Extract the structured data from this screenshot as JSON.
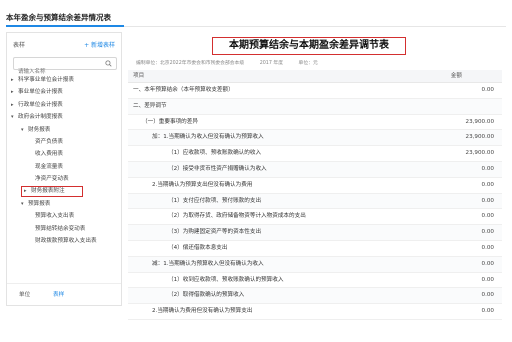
{
  "page": {
    "title": "本年盈余与预算结余差异情况表"
  },
  "sidebar": {
    "header": "表样",
    "add_label": "+ 新增表样",
    "search_placeholder": "请输入名称",
    "tree": [
      {
        "label": "科学事业单位会计报表",
        "arrow": "▸",
        "level": 0
      },
      {
        "label": "事业单位会计报表",
        "arrow": "▸",
        "level": 0
      },
      {
        "label": "行政单位会计报表",
        "arrow": "▸",
        "level": 0
      },
      {
        "label": "政府会计制度报表",
        "arrow": "▾",
        "level": 0
      },
      {
        "label": "财务报表",
        "arrow": "▾",
        "level": 1
      },
      {
        "label": "资产负债表",
        "arrow": "",
        "level": 2
      },
      {
        "label": "收入费用表",
        "arrow": "",
        "level": 2
      },
      {
        "label": "现金流量表",
        "arrow": "",
        "level": 2
      },
      {
        "label": "净资产变动表",
        "arrow": "",
        "level": 2
      },
      {
        "label": "财务报表附注",
        "arrow": "▸",
        "level": 1,
        "selected": true
      },
      {
        "label": "预算报表",
        "arrow": "▾",
        "level": 1
      },
      {
        "label": "预算收入支出表",
        "arrow": "",
        "level": 2
      },
      {
        "label": "预算结转结余变动表",
        "arrow": "",
        "level": 2
      },
      {
        "label": "财政拨款预算收入支出表",
        "arrow": "",
        "level": 2
      }
    ],
    "footer": {
      "tab_unit": "单位",
      "tab_table": "表样"
    }
  },
  "report": {
    "title": "本期预算结余与本期盈余差异调节表",
    "meta": [
      "编制单位：北京2022年市委会和市残委会部会本级",
      "2017 年度",
      "单位：元"
    ],
    "columns": {
      "item": "项目",
      "amount": "金额"
    },
    "rows": [
      {
        "label": "一、本年预算结余（本年预算收支差额）",
        "amount": "0.00",
        "indent": 0
      },
      {
        "label": "二、差异调节",
        "amount": "",
        "indent": 0
      },
      {
        "label": "（一）重要事项的差异",
        "amount": "23,900.00",
        "indent": 1
      },
      {
        "label": "加：1.当期确认为收入但没有确认为预算收入",
        "amount": "23,900.00",
        "indent": 2
      },
      {
        "label": "（1）应收款项、预收账款确认的收入",
        "amount": "23,900.00",
        "indent": 3
      },
      {
        "label": "（2）接受非货币性资产捐赠确认为收入",
        "amount": "0.00",
        "indent": 3
      },
      {
        "label": "2.当期确认为预算支出但没有确认为费用",
        "amount": "0.00",
        "indent": 2
      },
      {
        "label": "（1）支付应付款项、预付账款的支出",
        "amount": "0.00",
        "indent": 3
      },
      {
        "label": "（2）为取得存货、政府储备物资等计入物资成本的支出",
        "amount": "0.00",
        "indent": 3
      },
      {
        "label": "（3）为购建固定资产等的资本性支出",
        "amount": "0.00",
        "indent": 3
      },
      {
        "label": "（4）偿还借款本息支出",
        "amount": "0.00",
        "indent": 3
      },
      {
        "label": "减：1.当期确认为预算收入但没有确认为收入",
        "amount": "0.00",
        "indent": 2
      },
      {
        "label": "（1）收到应收款项、预收账款确认的预算收入",
        "amount": "0.00",
        "indent": 3
      },
      {
        "label": "（2）取得借款确认的预算收入",
        "amount": "0.00",
        "indent": 3
      },
      {
        "label": "2.当期确认为费用但没有确认为预算支出",
        "amount": "0.00",
        "indent": 2
      }
    ]
  }
}
